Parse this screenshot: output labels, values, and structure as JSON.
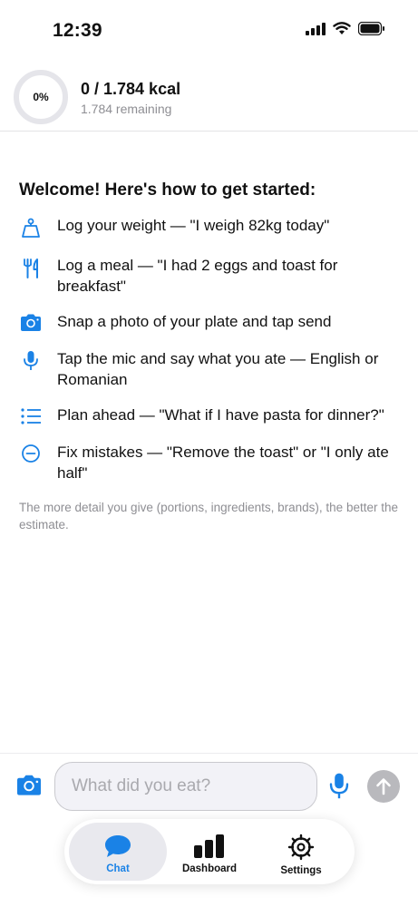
{
  "status_bar": {
    "time": "12:39",
    "icons": [
      "cellular-signal-icon",
      "wifi-icon",
      "battery-icon"
    ]
  },
  "header": {
    "progress_percent": 0,
    "progress_label": "0%",
    "kcal_summary": "0 / 1.784 kcal",
    "remaining": "1.784 remaining"
  },
  "welcome": {
    "title": "Welcome! Here's how to get started:",
    "tips": [
      {
        "icon": "scale-icon",
        "text": "Log your weight — \"I weigh 82kg today\""
      },
      {
        "icon": "fork-knife-icon",
        "text": "Log a meal — \"I had 2 eggs and toast for breakfast\""
      },
      {
        "icon": "camera-icon",
        "text": "Snap a photo of your plate and tap send"
      },
      {
        "icon": "mic-icon",
        "text": "Tap the mic and say what you ate — English or Romanian"
      },
      {
        "icon": "list-icon",
        "text": "Plan ahead — \"What if I have pasta for dinner?\""
      },
      {
        "icon": "minus-circle-icon",
        "text": "Fix mistakes — \"Remove the toast\" or \"I only ate half\""
      }
    ],
    "footnote": "The more detail you give (portions, ingredients, brands), the better the estimate."
  },
  "composer": {
    "placeholder": "What did you eat?",
    "value": ""
  },
  "tabs": [
    {
      "label": "Chat",
      "icon": "chat-bubble-icon",
      "active": true
    },
    {
      "label": "Dashboard",
      "icon": "bar-chart-icon",
      "active": false
    },
    {
      "label": "Settings",
      "icon": "gear-icon",
      "active": false
    }
  ],
  "colors": {
    "accent": "#1a82e6",
    "ring_track": "#e5e5ea",
    "send_disabled": "#b9b9bd",
    "muted_text": "#8e8e93"
  }
}
